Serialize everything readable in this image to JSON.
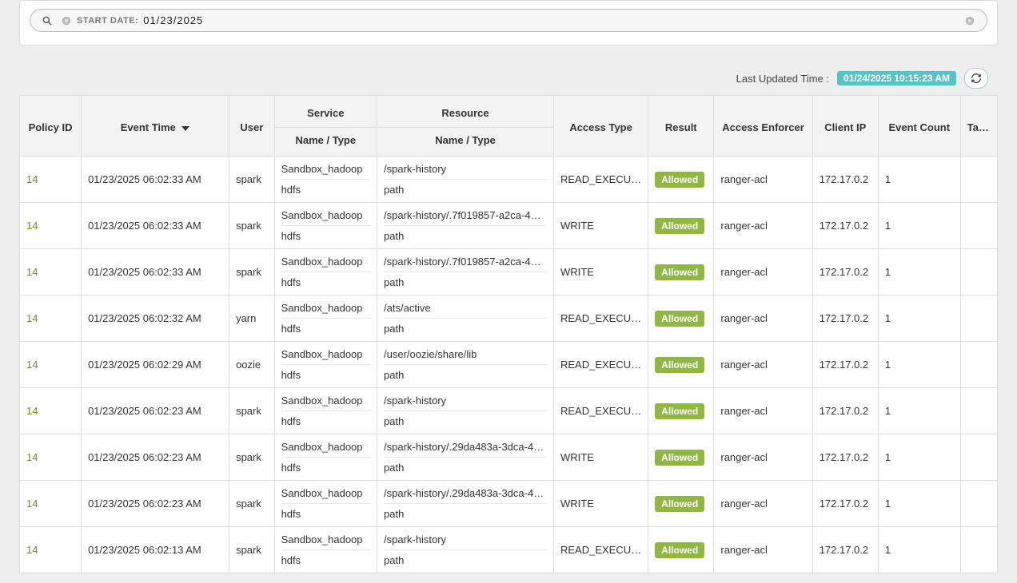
{
  "search": {
    "chip_label": "START DATE:",
    "chip_value": "01/23/2025"
  },
  "meta": {
    "last_updated_label": "Last Updated Time :",
    "last_updated_value": "01/24/2025 10:15:23 AM"
  },
  "columns": {
    "policy_id": "Policy ID",
    "event_time": "Event Time",
    "user": "User",
    "service_group": "Service",
    "resource_group": "Resource",
    "name_type": "Name / Type",
    "access_type": "Access Type",
    "result": "Result",
    "access_enforcer": "Access Enforcer",
    "client_ip": "Client IP",
    "event_count": "Event Count",
    "tags": "Tags"
  },
  "rows": [
    {
      "policy_id": "14",
      "event_time": "01/23/2025 06:02:33 AM",
      "user": "spark",
      "service_name": "Sandbox_hadoop",
      "service_type": "hdfs",
      "resource_name": "/spark-history",
      "resource_type": "path",
      "access_type": "READ_EXECUTE",
      "result": "Allowed",
      "enforcer": "ranger-acl",
      "client_ip": "172.17.0.2",
      "event_count": "1",
      "tags": ""
    },
    {
      "policy_id": "14",
      "event_time": "01/23/2025 06:02:33 AM",
      "user": "spark",
      "service_name": "Sandbox_hadoop",
      "service_type": "hdfs",
      "resource_name": "/spark-history/.7f019857-a2ca-4…",
      "resource_type": "path",
      "access_type": "WRITE",
      "result": "Allowed",
      "enforcer": "ranger-acl",
      "client_ip": "172.17.0.2",
      "event_count": "1",
      "tags": ""
    },
    {
      "policy_id": "14",
      "event_time": "01/23/2025 06:02:33 AM",
      "user": "spark",
      "service_name": "Sandbox_hadoop",
      "service_type": "hdfs",
      "resource_name": "/spark-history/.7f019857-a2ca-4…",
      "resource_type": "path",
      "access_type": "WRITE",
      "result": "Allowed",
      "enforcer": "ranger-acl",
      "client_ip": "172.17.0.2",
      "event_count": "1",
      "tags": ""
    },
    {
      "policy_id": "14",
      "event_time": "01/23/2025 06:02:32 AM",
      "user": "yarn",
      "service_name": "Sandbox_hadoop",
      "service_type": "hdfs",
      "resource_name": "/ats/active",
      "resource_type": "path",
      "access_type": "READ_EXECUTE",
      "result": "Allowed",
      "enforcer": "ranger-acl",
      "client_ip": "172.17.0.2",
      "event_count": "1",
      "tags": ""
    },
    {
      "policy_id": "14",
      "event_time": "01/23/2025 06:02:29 AM",
      "user": "oozie",
      "service_name": "Sandbox_hadoop",
      "service_type": "hdfs",
      "resource_name": "/user/oozie/share/lib",
      "resource_type": "path",
      "access_type": "READ_EXECUTE",
      "result": "Allowed",
      "enforcer": "ranger-acl",
      "client_ip": "172.17.0.2",
      "event_count": "1",
      "tags": ""
    },
    {
      "policy_id": "14",
      "event_time": "01/23/2025 06:02:23 AM",
      "user": "spark",
      "service_name": "Sandbox_hadoop",
      "service_type": "hdfs",
      "resource_name": "/spark-history",
      "resource_type": "path",
      "access_type": "READ_EXECUTE",
      "result": "Allowed",
      "enforcer": "ranger-acl",
      "client_ip": "172.17.0.2",
      "event_count": "1",
      "tags": ""
    },
    {
      "policy_id": "14",
      "event_time": "01/23/2025 06:02:23 AM",
      "user": "spark",
      "service_name": "Sandbox_hadoop",
      "service_type": "hdfs",
      "resource_name": "/spark-history/.29da483a-3dca-4…",
      "resource_type": "path",
      "access_type": "WRITE",
      "result": "Allowed",
      "enforcer": "ranger-acl",
      "client_ip": "172.17.0.2",
      "event_count": "1",
      "tags": ""
    },
    {
      "policy_id": "14",
      "event_time": "01/23/2025 06:02:23 AM",
      "user": "spark",
      "service_name": "Sandbox_hadoop",
      "service_type": "hdfs",
      "resource_name": "/spark-history/.29da483a-3dca-4…",
      "resource_type": "path",
      "access_type": "WRITE",
      "result": "Allowed",
      "enforcer": "ranger-acl",
      "client_ip": "172.17.0.2",
      "event_count": "1",
      "tags": ""
    },
    {
      "policy_id": "14",
      "event_time": "01/23/2025 06:02:13 AM",
      "user": "spark",
      "service_name": "Sandbox_hadoop",
      "service_type": "hdfs",
      "resource_name": "/spark-history",
      "resource_type": "path",
      "access_type": "READ_EXECUTE",
      "result": "Allowed",
      "enforcer": "ranger-acl",
      "client_ip": "172.17.0.2",
      "event_count": "1",
      "tags": ""
    }
  ]
}
